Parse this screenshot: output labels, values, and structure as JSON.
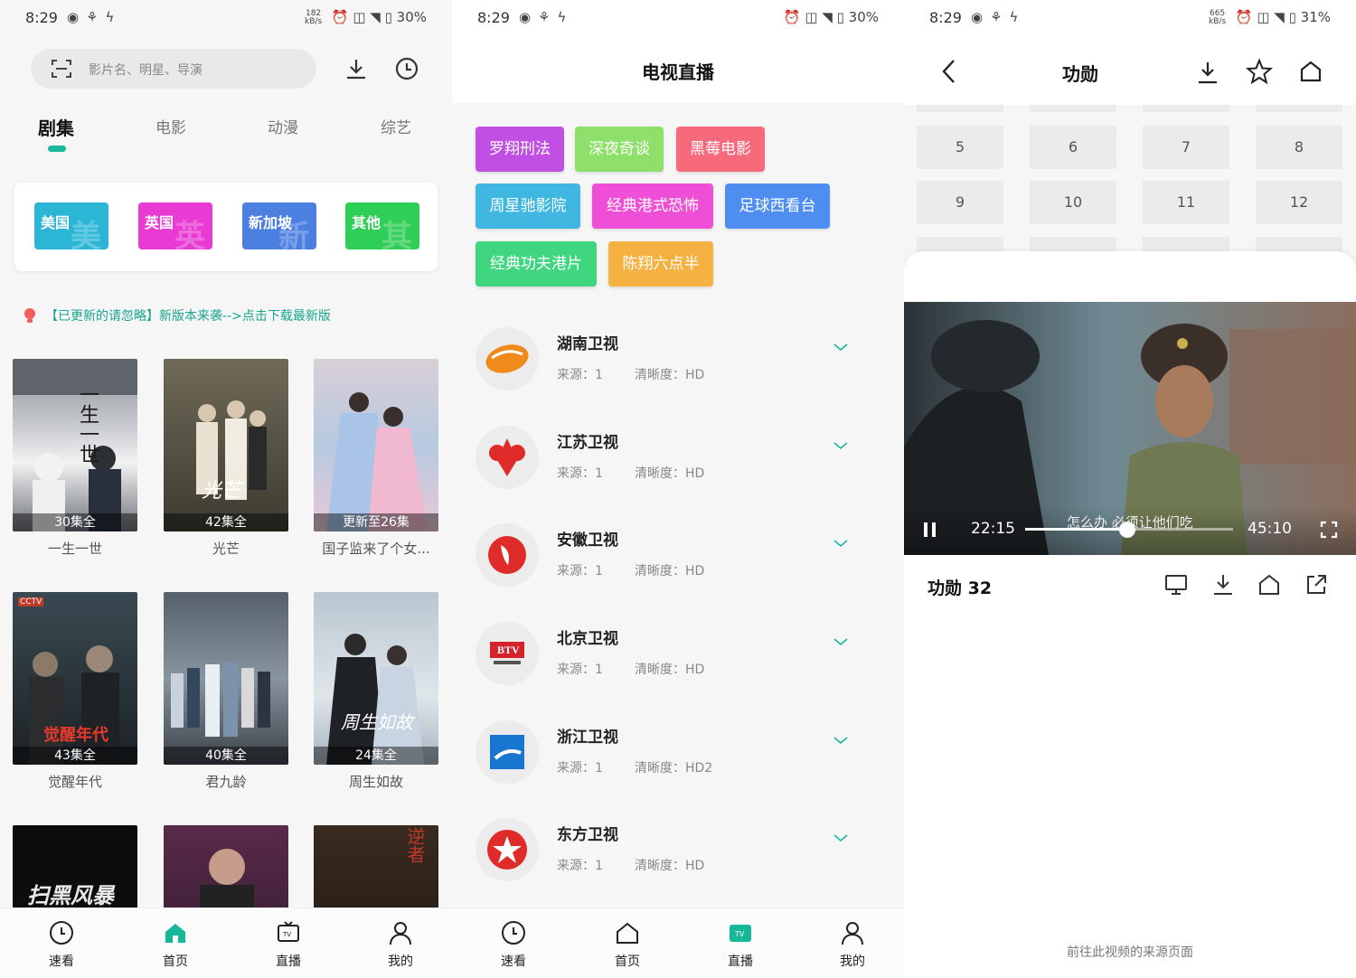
{
  "panel1": {
    "status": {
      "time": "8:29",
      "speed_num": "182",
      "speed_unit": "kB/s",
      "battery": "30%"
    },
    "search": {
      "placeholder": "影片名、明星、导演"
    },
    "tabs": [
      "剧集",
      "电影",
      "动漫",
      "综艺"
    ],
    "regions": [
      {
        "label": "美国",
        "ghost": "美",
        "color": "#2bb6d6"
      },
      {
        "label": "英国",
        "ghost": "英",
        "color": "#e93ad3"
      },
      {
        "label": "新加坡",
        "ghost": "新",
        "color": "#4b7fe0"
      },
      {
        "label": "其他",
        "ghost": "其",
        "color": "#2fce57"
      }
    ],
    "notice": "【已更新的请忽略】新版本来袭-->点击下载最新版",
    "cards": [
      {
        "ep": "30集全",
        "title": "一生一世"
      },
      {
        "ep": "42集全",
        "title": "光芒"
      },
      {
        "ep": "更新至26集",
        "title": "国子监来了个女..."
      },
      {
        "ep": "43集全",
        "title": "觉醒年代"
      },
      {
        "ep": "40集全",
        "title": "君九龄"
      },
      {
        "ep": "24集全",
        "title": "周生如故"
      }
    ],
    "poster_texts": {
      "p1": "一生一世",
      "p2": "光芒",
      "p4_top": "CCTV",
      "p4": "觉醒年代",
      "p6": "周生如故",
      "p7": "扫黑风暴",
      "p9": "逆者"
    },
    "nav": [
      "速看",
      "首页",
      "直播",
      "我的"
    ]
  },
  "panel2": {
    "status": {
      "time": "8:29",
      "battery": "30%"
    },
    "title": "电视直播",
    "tags": [
      {
        "label": "罗翔刑法",
        "color": "#c14fe3"
      },
      {
        "label": "深夜奇谈",
        "color": "#8fe06a"
      },
      {
        "label": "黑莓电影",
        "color": "#f76a7c"
      },
      {
        "label": "周星驰影院",
        "color": "#3fb7e0"
      },
      {
        "label": "经典港式恐怖",
        "color": "#ef4fd6"
      },
      {
        "label": "足球西看台",
        "color": "#4f8ef0"
      },
      {
        "label": "经典功夫港片",
        "color": "#3fd67f"
      },
      {
        "label": "陈翔六点半",
        "color": "#f5b141"
      }
    ],
    "source_label": "来源：",
    "quality_label": "清晰度：",
    "channels": [
      {
        "name": "湖南卫视",
        "source": "1",
        "quality": "HD",
        "logo": "hunan-tv-logo"
      },
      {
        "name": "江苏卫视",
        "source": "1",
        "quality": "HD",
        "logo": "jiangsu-tv-logo"
      },
      {
        "name": "安徽卫视",
        "source": "1",
        "quality": "HD",
        "logo": "anhui-tv-logo"
      },
      {
        "name": "北京卫视",
        "source": "1",
        "quality": "HD",
        "logo": "beijing-tv-logo"
      },
      {
        "name": "浙江卫视",
        "source": "1",
        "quality": "HD2",
        "logo": "zhejiang-tv-logo"
      },
      {
        "name": "东方卫视",
        "source": "1",
        "quality": "HD",
        "logo": "dragon-tv-logo"
      }
    ],
    "btv_text": "BTV",
    "nav": [
      "速看",
      "首页",
      "直播",
      "我的"
    ]
  },
  "panel3": {
    "status": {
      "time": "8:29",
      "speed_num": "665",
      "speed_unit": "kB/s",
      "battery": "31%"
    },
    "title": "功勋",
    "episodes": [
      "5",
      "6",
      "7",
      "8",
      "9",
      "10",
      "11",
      "12"
    ],
    "player": {
      "elapsed": "22:15",
      "total": "45:10",
      "progress": 0.49,
      "subtitle": "怎么办 必须让他们吃"
    },
    "episode_title": "功勋 32",
    "source_link": "前往此视频的来源页面"
  },
  "colors": {
    "accent": "#17b79a"
  }
}
